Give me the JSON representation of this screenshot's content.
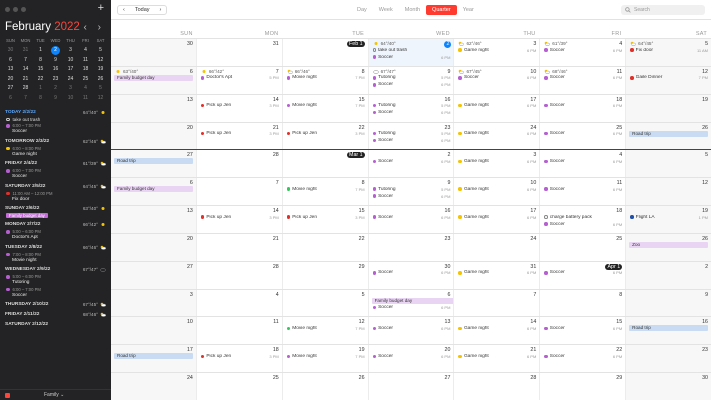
{
  "colors": {
    "accent": "#ff3b30",
    "today": "#0a84ff",
    "purple": "#b55fd0",
    "green": "#34c759",
    "red": "#e0302a",
    "yellow": "#f5c400",
    "blue_bar": "#c9dbf2",
    "purple_bar": "#ead4f4"
  },
  "sidebar": {
    "add_label": "+",
    "month": "February",
    "year": "2022",
    "nav": "‹ ›",
    "dow": [
      "SUN",
      "MON",
      "TUE",
      "WED",
      "THU",
      "FRI",
      "SAT"
    ],
    "weeks": [
      [
        "30",
        "31",
        "1",
        "2",
        "3",
        "4",
        "5"
      ],
      [
        "6",
        "7",
        "8",
        "9",
        "10",
        "11",
        "12"
      ],
      [
        "13",
        "14",
        "15",
        "16",
        "17",
        "18",
        "19"
      ],
      [
        "20",
        "21",
        "22",
        "23",
        "24",
        "25",
        "26"
      ],
      [
        "27",
        "28",
        "1",
        "2",
        "3",
        "4",
        "5"
      ],
      [
        "6",
        "7",
        "8",
        "9",
        "10",
        "11",
        "12"
      ]
    ],
    "agenda": [
      {
        "label": "TODAY 2/2/22",
        "weather": "64°/40°",
        "icon": "sun-icon",
        "today": true,
        "events": [
          {
            "title": "take out trash",
            "time": "",
            "color": "hollow"
          },
          {
            "title": "Soccer",
            "time": "6:00 – 7:00 PM",
            "color": "#b55fd0"
          }
        ]
      },
      {
        "label": "TOMORROW 2/3/22",
        "weather": "62°/46°",
        "icon": "partly-cloudy-icon",
        "events": [
          {
            "title": "Game night",
            "time": "6:00 – 8:00 PM",
            "color": "#f5c400"
          }
        ]
      },
      {
        "label": "FRIDAY 2/4/22",
        "weather": "61°/39°",
        "icon": "partly-cloudy-icon",
        "events": [
          {
            "title": "Soccer",
            "time": "6:00 – 7:00 PM",
            "color": "#b55fd0"
          }
        ]
      },
      {
        "label": "SATURDAY 2/5/22",
        "weather": "64°/45°",
        "icon": "partly-cloudy-icon",
        "events": [
          {
            "title": "Fix door",
            "time": "11:00 AM – 12:00 PM",
            "color": "#e0302a"
          }
        ]
      },
      {
        "label": "SUNDAY 2/6/22",
        "weather": "63°/40°",
        "icon": "sun-icon",
        "pill": "Family budget day",
        "events": []
      },
      {
        "label": "MONDAY 2/7/22",
        "weather": "66°/42°",
        "icon": "sun-icon",
        "events": [
          {
            "title": "Doctor's Apt",
            "time": "5:00 – 6:00 PM",
            "color": "#b55fd0"
          }
        ]
      },
      {
        "label": "TUESDAY 2/8/22",
        "weather": "66°/46°",
        "icon": "partly-cloudy-icon",
        "events": [
          {
            "title": "Movie night",
            "time": "7:00 – 8:00 PM",
            "color": "#b55fd0"
          }
        ]
      },
      {
        "label": "WEDNESDAY 2/9/22",
        "weather": "67°/47°",
        "icon": "cloud-icon",
        "events": [
          {
            "title": "Tutoring",
            "time": "5:00 – 6:00 PM",
            "color": "#b55fd0"
          },
          {
            "title": "Soccer",
            "time": "6:00 – 7:00 PM",
            "color": "#b55fd0"
          }
        ]
      },
      {
        "label": "THURSDAY 2/10/22",
        "weather": "67°/45°",
        "icon": "partly-cloudy-icon",
        "events": []
      },
      {
        "label": "FRIDAY 2/11/22",
        "weather": "68°/46°",
        "icon": "partly-cloudy-icon",
        "events": []
      },
      {
        "label": "SATURDAY 2/12/22",
        "weather": "",
        "icon": "",
        "events": []
      }
    ],
    "filter_label": "Family ⌄"
  },
  "toolbar": {
    "prev": "‹",
    "today": "Today",
    "next": "›",
    "tabs": [
      {
        "label": "Day"
      },
      {
        "label": "Week"
      },
      {
        "label": "Month"
      },
      {
        "label": "Quarter",
        "active": true
      },
      {
        "label": "Year"
      }
    ],
    "search_placeholder": "Search"
  },
  "grid": {
    "dow": [
      "SUN",
      "MON",
      "TUE",
      "WED",
      "THU",
      "FRI",
      "SAT"
    ],
    "weeks": [
      {
        "days": [
          {
            "n": "30"
          },
          {
            "n": "31"
          },
          {
            "n": "Feb 1",
            "badge": true,
            "mstart": true
          },
          {
            "n": "2",
            "today": true,
            "hl": true,
            "wx": "64°/40°",
            "wxicon": "sun-icon",
            "ev": [
              {
                "t": "take out trash",
                "c": "hollow"
              },
              {
                "t": "Soccer",
                "c": "#b55fd0",
                "tm": "6 PM"
              }
            ]
          },
          {
            "n": "3",
            "wx": "62°/46°",
            "wxicon": "partly-cloudy-icon",
            "ev": [
              {
                "t": "Game night",
                "c": "#f5c400",
                "tm": "6 PM"
              }
            ]
          },
          {
            "n": "4",
            "wx": "61°/39°",
            "wxicon": "partly-cloudy-icon",
            "ev": [
              {
                "t": "Soccer",
                "c": "#b55fd0",
                "tm": "6 PM"
              }
            ]
          },
          {
            "n": "5",
            "wx": "64°/45°",
            "wxicon": "partly-cloudy-icon",
            "ev": [
              {
                "t": "Fix door",
                "c": "#e0302a",
                "tm": "11 AM"
              }
            ]
          }
        ]
      },
      {
        "bars": [
          {
            "t": "Family budget day",
            "from": 0,
            "to": 0,
            "c": "#ead4f4",
            "row": 1
          }
        ],
        "days": [
          {
            "n": "6",
            "wx": "63°/40°",
            "wxicon": "sun-icon"
          },
          {
            "n": "7",
            "wx": "66°/42°",
            "wxicon": "sun-icon",
            "ev": [
              {
                "t": "Doctor's Apt",
                "c": "#b55fd0",
                "tm": "5 PM"
              }
            ]
          },
          {
            "n": "8",
            "wx": "66°/46°",
            "wxicon": "partly-cloudy-icon",
            "ev": [
              {
                "t": "Movie night",
                "c": "#b55fd0",
                "tm": "7 PM"
              }
            ]
          },
          {
            "n": "9",
            "wx": "67°/47°",
            "wxicon": "cloud-icon",
            "ev": [
              {
                "t": "Tutoring",
                "c": "#b55fd0",
                "tm": "5 PM"
              },
              {
                "t": "Soccer",
                "c": "#b55fd0",
                "tm": "6 PM"
              }
            ]
          },
          {
            "n": "10",
            "wx": "67°/45°",
            "wxicon": "partly-cloudy-icon",
            "ev": [
              {
                "t": "Soccer",
                "c": "#b55fd0",
                "tm": "6 PM"
              }
            ]
          },
          {
            "n": "11",
            "wx": "68°/46°",
            "wxicon": "partly-cloudy-icon",
            "ev": [
              {
                "t": "Soccer",
                "c": "#b55fd0",
                "tm": "6 PM"
              }
            ]
          },
          {
            "n": "12",
            "ev": [
              {
                "t": "Gaile Dinner",
                "c": "#e0302a",
                "tm": "7 PM"
              }
            ]
          }
        ]
      },
      {
        "days": [
          {
            "n": "13"
          },
          {
            "n": "14",
            "ev": [
              {
                "t": "Pick up Jen",
                "c": "#e0302a",
                "tm": "3 PM"
              }
            ]
          },
          {
            "n": "15",
            "ev": [
              {
                "t": "Movie night",
                "c": "#b55fd0",
                "tm": "7 PM"
              }
            ]
          },
          {
            "n": "16",
            "ev": [
              {
                "t": "Tutoring",
                "c": "#b55fd0",
                "tm": "5 PM"
              },
              {
                "t": "Soccer",
                "c": "#b55fd0",
                "tm": "6 PM"
              }
            ]
          },
          {
            "n": "17",
            "ev": [
              {
                "t": "Game night",
                "c": "#f5c400",
                "tm": "6 PM"
              }
            ]
          },
          {
            "n": "18",
            "ev": [
              {
                "t": "Soccer",
                "c": "#b55fd0",
                "tm": "6 PM"
              }
            ]
          },
          {
            "n": "19"
          }
        ]
      },
      {
        "bars": [
          {
            "t": "Road trip",
            "from": 6,
            "to": 6,
            "c": "#c9dbf2",
            "row": 1
          }
        ],
        "days": [
          {
            "n": "20"
          },
          {
            "n": "21",
            "ev": [
              {
                "t": "Pick up Jen",
                "c": "#e0302a",
                "tm": "3 PM"
              }
            ]
          },
          {
            "n": "22",
            "ev": [
              {
                "t": "Pick up Jen",
                "c": "#e0302a",
                "tm": "3 PM"
              }
            ]
          },
          {
            "n": "23",
            "ev": [
              {
                "t": "Tutoring",
                "c": "#b55fd0",
                "tm": "5 PM"
              },
              {
                "t": "Soccer",
                "c": "#b55fd0",
                "tm": "6 PM"
              }
            ]
          },
          {
            "n": "24",
            "ev": [
              {
                "t": "Game night",
                "c": "#f5c400",
                "tm": "6 PM"
              }
            ]
          },
          {
            "n": "25",
            "ev": [
              {
                "t": "Soccer",
                "c": "#b55fd0",
                "tm": "6 PM"
              }
            ]
          },
          {
            "n": "26"
          }
        ]
      },
      {
        "bars": [
          {
            "t": "Road trip",
            "from": 0,
            "to": 0,
            "c": "#c9dbf2",
            "row": 1
          }
        ],
        "days": [
          {
            "n": "27"
          },
          {
            "n": "28"
          },
          {
            "n": "Mar 1",
            "badge": true,
            "mstart": true
          },
          {
            "n": "2",
            "ev": [
              {
                "t": "Soccer",
                "c": "#b55fd0",
                "tm": "6 PM"
              }
            ]
          },
          {
            "n": "3",
            "ev": [
              {
                "t": "Game night",
                "c": "#f5c400",
                "tm": "6 PM"
              }
            ]
          },
          {
            "n": "4",
            "ev": [
              {
                "t": "Soccer",
                "c": "#b55fd0",
                "tm": "6 PM"
              }
            ]
          },
          {
            "n": "5"
          }
        ]
      },
      {
        "bars": [
          {
            "t": "Family budget day",
            "from": 0,
            "to": 0,
            "c": "#ead4f4",
            "row": 1
          }
        ],
        "days": [
          {
            "n": "6"
          },
          {
            "n": "7"
          },
          {
            "n": "8",
            "ev": [
              {
                "t": "Movie night",
                "c": "#34c759",
                "tm": "7 PM"
              }
            ]
          },
          {
            "n": "9",
            "ev": [
              {
                "t": "Tutoring",
                "c": "#b55fd0",
                "tm": "5 PM"
              },
              {
                "t": "Soccer",
                "c": "#b55fd0",
                "tm": "6 PM"
              }
            ]
          },
          {
            "n": "10",
            "ev": [
              {
                "t": "Game night",
                "c": "#f5c400",
                "tm": "6 PM"
              }
            ]
          },
          {
            "n": "11",
            "ev": [
              {
                "t": "Soccer",
                "c": "#b55fd0",
                "tm": "6 PM"
              }
            ]
          },
          {
            "n": "12"
          }
        ]
      },
      {
        "days": [
          {
            "n": "13"
          },
          {
            "n": "14",
            "ev": [
              {
                "t": "Pick up Jen",
                "c": "#e0302a",
                "tm": "3 PM"
              }
            ]
          },
          {
            "n": "15",
            "ev": [
              {
                "t": "Pick up Jen",
                "c": "#e0302a",
                "tm": "3 PM"
              }
            ]
          },
          {
            "n": "16",
            "ev": [
              {
                "t": "Soccer",
                "c": "#b55fd0",
                "tm": "6 PM"
              }
            ]
          },
          {
            "n": "17",
            "ev": [
              {
                "t": "Game night",
                "c": "#f5c400",
                "tm": "6 PM"
              }
            ]
          },
          {
            "n": "18",
            "ev": [
              {
                "t": "charge battery pack",
                "c": "hollow"
              },
              {
                "t": "Soccer",
                "c": "#b55fd0",
                "tm": "6 PM"
              }
            ]
          },
          {
            "n": "19",
            "ev": [
              {
                "t": "Flight LA",
                "c": "#1f4fa8",
                "tm": "1 PM"
              }
            ]
          }
        ]
      },
      {
        "bars": [
          {
            "t": "Zoo",
            "from": 6,
            "to": 6,
            "c": "#ead4f4",
            "row": 1
          }
        ],
        "days": [
          {
            "n": "20"
          },
          {
            "n": "21"
          },
          {
            "n": "22"
          },
          {
            "n": "23"
          },
          {
            "n": "24"
          },
          {
            "n": "25"
          },
          {
            "n": "26"
          }
        ]
      },
      {
        "days": [
          {
            "n": "27"
          },
          {
            "n": "28"
          },
          {
            "n": "29"
          },
          {
            "n": "30",
            "ev": [
              {
                "t": "Soccer",
                "c": "#b55fd0",
                "tm": "6 PM"
              }
            ]
          },
          {
            "n": "31",
            "ev": [
              {
                "t": "Game night",
                "c": "#f5c400",
                "tm": "6 PM"
              }
            ]
          },
          {
            "n": "Apr 1",
            "badge": true,
            "mstart": true,
            "ev": [
              {
                "t": "Soccer",
                "c": "#b55fd0",
                "tm": "6 PM"
              }
            ]
          },
          {
            "n": "2"
          }
        ]
      },
      {
        "bars": [
          {
            "t": "Family budget day",
            "from": 3,
            "to": 4,
            "c": "#ead4f4",
            "row": 1
          }
        ],
        "days": [
          {
            "n": "3"
          },
          {
            "n": "4"
          },
          {
            "n": "5"
          },
          {
            "n": "6",
            "ev": [
              {
                "t": "Soccer",
                "c": "#b55fd0",
                "tm": "6 PM"
              }
            ]
          },
          {
            "n": "7"
          },
          {
            "n": "8"
          },
          {
            "n": "9"
          }
        ]
      },
      {
        "bars": [
          {
            "t": "Road trip",
            "from": 6,
            "to": 6,
            "c": "#c9dbf2",
            "row": 1
          }
        ],
        "days": [
          {
            "n": "10"
          },
          {
            "n": "11"
          },
          {
            "n": "12",
            "ev": [
              {
                "t": "Movie night",
                "c": "#34c759",
                "tm": "7 PM"
              }
            ]
          },
          {
            "n": "13",
            "ev": [
              {
                "t": "Soccer",
                "c": "#b55fd0",
                "tm": "6 PM"
              }
            ]
          },
          {
            "n": "14",
            "ev": [
              {
                "t": "Game night",
                "c": "#f5c400",
                "tm": "6 PM"
              }
            ]
          },
          {
            "n": "15",
            "ev": [
              {
                "t": "Soccer",
                "c": "#b55fd0",
                "tm": "6 PM"
              }
            ]
          },
          {
            "n": "16"
          }
        ]
      },
      {
        "bars": [
          {
            "t": "Road trip",
            "from": 0,
            "to": 0,
            "c": "#c9dbf2",
            "row": 1
          }
        ],
        "days": [
          {
            "n": "17"
          },
          {
            "n": "18",
            "ev": [
              {
                "t": "Pick up Jen",
                "c": "#e0302a",
                "tm": "3 PM"
              }
            ]
          },
          {
            "n": "19",
            "ev": [
              {
                "t": "Movie night",
                "c": "#b55fd0",
                "tm": "7 PM"
              }
            ]
          },
          {
            "n": "20",
            "ev": [
              {
                "t": "Soccer",
                "c": "#b55fd0",
                "tm": "6 PM"
              }
            ]
          },
          {
            "n": "21",
            "ev": [
              {
                "t": "Game night",
                "c": "#f5c400",
                "tm": "6 PM"
              }
            ]
          },
          {
            "n": "22",
            "ev": [
              {
                "t": "Soccer",
                "c": "#b55fd0",
                "tm": "6 PM"
              }
            ]
          },
          {
            "n": "23"
          }
        ]
      },
      {
        "days": [
          {
            "n": "24"
          },
          {
            "n": "25"
          },
          {
            "n": "26"
          },
          {
            "n": "27"
          },
          {
            "n": "28"
          },
          {
            "n": "29"
          },
          {
            "n": "30"
          }
        ]
      }
    ]
  }
}
